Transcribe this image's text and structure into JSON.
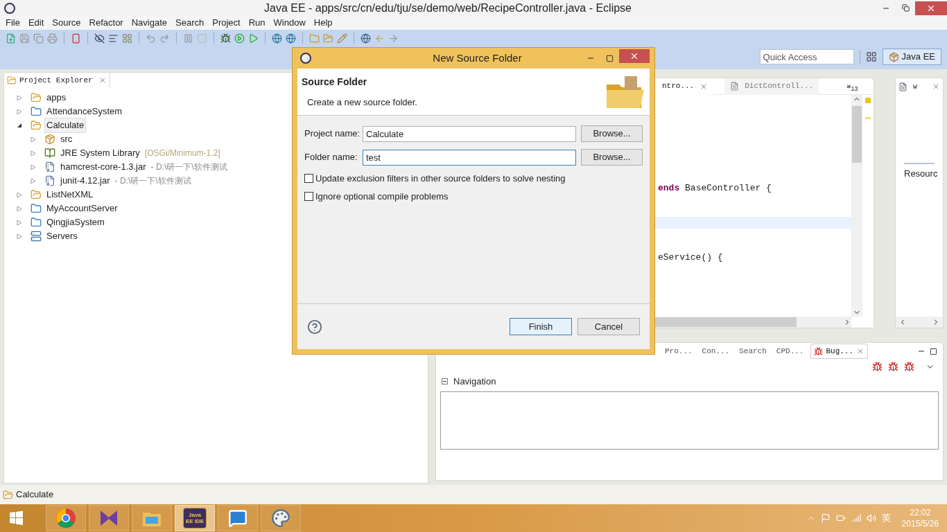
{
  "window": {
    "title": "Java EE - apps/src/cn/edu/tju/se/demo/web/RecipeController.java - Eclipse"
  },
  "menu": [
    "File",
    "Edit",
    "Source",
    "Refactor",
    "Navigate",
    "Search",
    "Project",
    "Run",
    "Window",
    "Help"
  ],
  "quick_access": {
    "placeholder": "Quick Access"
  },
  "perspective": {
    "label": "Java EE",
    "selected": true
  },
  "project_explorer": {
    "title": "Project Explorer",
    "items": [
      {
        "label": "apps",
        "kind": "project",
        "expanded": false,
        "selected": false
      },
      {
        "label": "AttendanceSystem",
        "kind": "folder",
        "expanded": false,
        "selected": false
      },
      {
        "label": "Calculate",
        "kind": "project",
        "expanded": true,
        "selected": true,
        "children": [
          {
            "label": "src",
            "kind": "package",
            "expanded": false,
            "selected": false
          },
          {
            "label": "JRE System Library",
            "decoration": "[OSGi/Minimum-1.2]",
            "kind": "library",
            "expanded": false,
            "selected": false
          },
          {
            "label": "hamcrest-core-1.3.jar",
            "decoration": "- D:\\研一下\\软件测试",
            "kind": "jar",
            "expanded": false,
            "selected": false
          },
          {
            "label": "junit-4.12.jar",
            "decoration": "- D:\\研一下\\软件测试",
            "kind": "jar",
            "expanded": false,
            "selected": false
          }
        ]
      },
      {
        "label": "ListNetXML",
        "kind": "project",
        "expanded": false,
        "selected": false
      },
      {
        "label": "MyAccountServer",
        "kind": "folder",
        "expanded": false,
        "selected": false
      },
      {
        "label": "QingjiaSystem",
        "kind": "folder",
        "expanded": false,
        "selected": false
      },
      {
        "label": "Servers",
        "kind": "servers",
        "expanded": false,
        "selected": false
      }
    ]
  },
  "editor": {
    "tabs": [
      {
        "label": "ntro...",
        "selected": true
      },
      {
        "label": "DictControll...",
        "selected": false
      }
    ],
    "overflow": {
      "label": "»",
      "count": "13"
    },
    "lines": [
      {
        "keyword": "ends",
        "text": "BaseController {",
        "highlighted": false
      },
      {
        "highlighted": true
      },
      {
        "text": "eService() {",
        "highlighted": false
      }
    ]
  },
  "right_view": {
    "tab": "w",
    "label": "Resourc"
  },
  "bottom_panel": {
    "tabs": [
      {
        "label": "Pro...",
        "selected": false
      },
      {
        "label": "Con...",
        "selected": false
      },
      {
        "label": "Search",
        "selected": false
      },
      {
        "label": "CPD...",
        "selected": false
      },
      {
        "label": "Bug...",
        "selected": true
      }
    ],
    "section": {
      "title": "Navigation",
      "expanded": true
    }
  },
  "status_bar": {
    "text": "Calculate"
  },
  "dialog": {
    "title": "New Source Folder",
    "heading": "Source Folder",
    "description": "Create a new source folder.",
    "fields": [
      {
        "label": "Project name:",
        "value": "Calculate",
        "focused": false,
        "button": "Browse..."
      },
      {
        "label": "Folder name:",
        "value": "test",
        "focused": true,
        "button": "Browse..."
      }
    ],
    "options": [
      {
        "label": "Update exclusion filters in other source folders to solve nesting",
        "checked": false
      },
      {
        "label": "Ignore optional compile problems",
        "checked": false
      }
    ],
    "buttons": [
      {
        "label": "Finish",
        "default": true
      },
      {
        "label": "Cancel",
        "default": false
      }
    ]
  },
  "taskbar": {
    "apps": [
      {
        "kind": "browser",
        "active": false
      },
      {
        "kind": "studio",
        "active": false
      },
      {
        "kind": "files",
        "active": false
      },
      {
        "kind": "eclipse",
        "label": "Java EE IDE",
        "active": true
      },
      {
        "kind": "chat",
        "active": false
      },
      {
        "kind": "paint",
        "active": false
      }
    ],
    "tray": {
      "ime": "英",
      "time": "22:02",
      "date": "2015/5/26"
    }
  }
}
